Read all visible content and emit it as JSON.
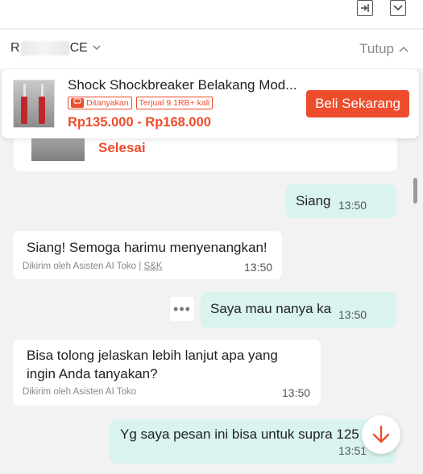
{
  "shop": {
    "name_prefix": "R",
    "name_suffix": "CE",
    "close_label": "Tutup"
  },
  "product": {
    "title": "Shock Shockbreaker Belakang Mod...",
    "badge_asked": "Ditanyakan",
    "badge_sold": "Terjual 9.1RB+ kali",
    "price": "Rp135.000 - Rp168.000",
    "buy_label": "Beli Sekarang"
  },
  "previous_order": {
    "status": "Selesai"
  },
  "messages": [
    {
      "from": "me",
      "text": "Siang",
      "time": "13:50"
    },
    {
      "from": "shop",
      "text": "Siang! Semoga harimu menyenangkan!",
      "sender": "Dikirim oleh Asisten AI Toko",
      "sender_tag": "S&K",
      "time": "13:50"
    },
    {
      "from": "me",
      "text": "Saya mau nanya ka",
      "time": "13:50"
    },
    {
      "from": "shop",
      "text_line1": "Bisa tolong jelaskan lebih lanjut apa yang",
      "text_line2": "ingin Anda tanyakan?",
      "sender": "Dikirim oleh Asisten AI Toko",
      "time": "13:50"
    },
    {
      "from": "me",
      "text": "Yg saya pesan ini bisa untuk supra 125",
      "time": "13:51"
    }
  ],
  "colors": {
    "accent": "#ee4d2d",
    "my_bubble": "#d9f3ef",
    "their_bubble": "#ffffff",
    "background": "#f2f2f2"
  },
  "icons": {
    "top_left": "enter-icon",
    "top_right": "minimize-icon",
    "more": "more-icon",
    "scroll": "arrow-down-icon"
  }
}
